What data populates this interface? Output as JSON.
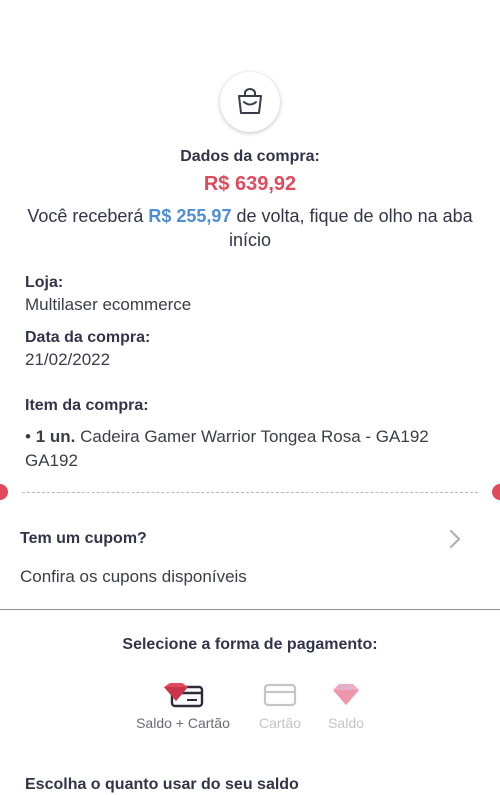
{
  "purchase": {
    "heading": "Dados da compra:",
    "total": "R$ 639,92",
    "cashback_prefix": "Você receberá ",
    "cashback_amount": "R$ 255,97",
    "cashback_suffix": " de volta, fique de olho na aba início"
  },
  "details": {
    "store_label": "Loja:",
    "store_value": "Multilaser ecommerce",
    "date_label": "Data da compra:",
    "date_value": "21/02/2022",
    "item_label": "Item da compra:",
    "item_bullet": "• ",
    "item_qty": "1 un.",
    "item_name": " Cadeira Gamer Warrior Tongea Rosa - GA192 GA192"
  },
  "coupon": {
    "title": "Tem um cupom?",
    "subtitle": "Confira os cupons disponíveis"
  },
  "payment": {
    "title": "Selecione a forma de pagamento:",
    "options": [
      {
        "label": "Saldo + Cartão",
        "icon": "balance-card-icon",
        "selected": true
      },
      {
        "label": "Cartão",
        "icon": "card-icon",
        "selected": false
      },
      {
        "label": "Saldo",
        "icon": "diamond-icon",
        "selected": false
      }
    ]
  },
  "balance": {
    "title": "Escolha o quanto usar do seu saldo"
  },
  "colors": {
    "accent_red": "#e04a5c",
    "cashback_blue": "#4f8ed6",
    "text_dark": "#33334a"
  }
}
